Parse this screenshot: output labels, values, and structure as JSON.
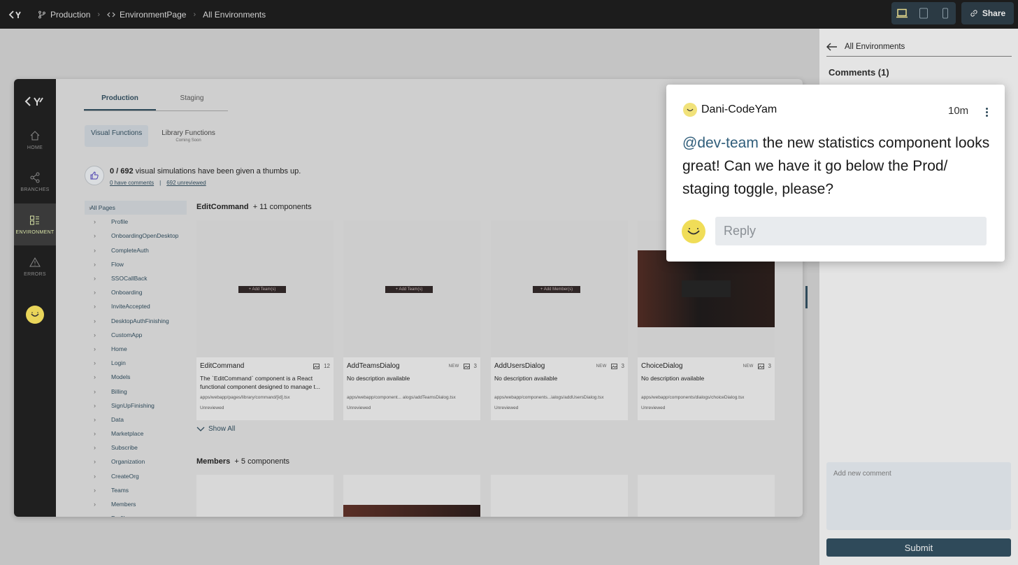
{
  "topbar": {
    "breadcrumbs": [
      "Production",
      "EnvironmentPage",
      "All Environments"
    ],
    "share_label": "Share",
    "icons": [
      "branch-icon",
      "code-icon",
      "laptop-icon",
      "tablet-icon",
      "phone-icon",
      "link-icon"
    ]
  },
  "app": {
    "nav": [
      {
        "label": "HOME",
        "icon": "home-icon"
      },
      {
        "label": "BRANCHES",
        "icon": "share-icon"
      },
      {
        "label": "ENVIRONMENT",
        "icon": "layout-icon"
      },
      {
        "label": "ERRORS",
        "icon": "warning-icon"
      }
    ],
    "env_tabs": [
      "Production",
      "Staging"
    ],
    "func_tabs": {
      "visual": "Visual Functions",
      "library": "Library Functions",
      "library_sub": "Coming Soon"
    },
    "stats": {
      "count": "0 / 692",
      "text": " visual simulations have been given a thumbs up.",
      "comments_link": "0 have comments",
      "sep": "|",
      "unreviewed_link": "692 unreviewed"
    },
    "tree": [
      "All Pages",
      "Profile",
      "OnboardingOpenDesktop",
      "CompleteAuth",
      "Flow",
      "SSOCallBack",
      "Onboarding",
      "InviteAccepted",
      "DesktopAuthFinishing",
      "CustomApp",
      "Home",
      "Login",
      "Models",
      "Billing",
      "SignUpFinishing",
      "Data",
      "Marketplace",
      "Subscribe",
      "Organization",
      "CreateOrg",
      "Teams",
      "Members",
      "Profile"
    ],
    "section1": {
      "name": "EditCommand",
      "count": "+ 11 components"
    },
    "cards": [
      {
        "name": "EditCommand",
        "new": "",
        "shots": "12",
        "desc": "The `EditCommand` component is a React functional component designed to manage t...",
        "path": "apps/webapp/pages/library/command/[id].tsx",
        "status": "Unreviewed",
        "pill": "+ Add Team(s)"
      },
      {
        "name": "AddTeamsDialog",
        "new": "NEW",
        "shots": "3",
        "desc": "No description available",
        "path": "apps/webapp/component... alogs/addTeamsDialog.tsx",
        "status": "Unreviewed",
        "pill": "+ Add Team(s)"
      },
      {
        "name": "AddUsersDialog",
        "new": "NEW",
        "shots": "3",
        "desc": "No description available",
        "path": "apps/webapp/components...ialogs/addUsersDialog.tsx",
        "status": "Unreviewed",
        "pill": "+ Add Member(s)"
      },
      {
        "name": "ChoiceDialog",
        "new": "NEW",
        "shots": "3",
        "desc": "No description available",
        "path": "apps/webapp/components/dialogs/choiceDialog.tsx",
        "status": "Unreviewed",
        "pill": ""
      }
    ],
    "show_all": "Show All",
    "section2": {
      "name": "Members",
      "count": "+ 5 components"
    }
  },
  "panel": {
    "back_label": "All Environments",
    "comments_title": "Comments (1)",
    "add_placeholder": "Add new comment",
    "submit_label": "Submit"
  },
  "comment": {
    "user": "Dani-CodeYam",
    "time": "10m",
    "mention": "@dev-team",
    "text": " the new statistics component looks great! Can we have it go below the Prod/ staging toggle, please?",
    "reply_placeholder": "Reply"
  },
  "colors": {
    "accent": "#2f4a5a",
    "avatar": "#f0dd58",
    "topbar": "#1c1c1c"
  }
}
